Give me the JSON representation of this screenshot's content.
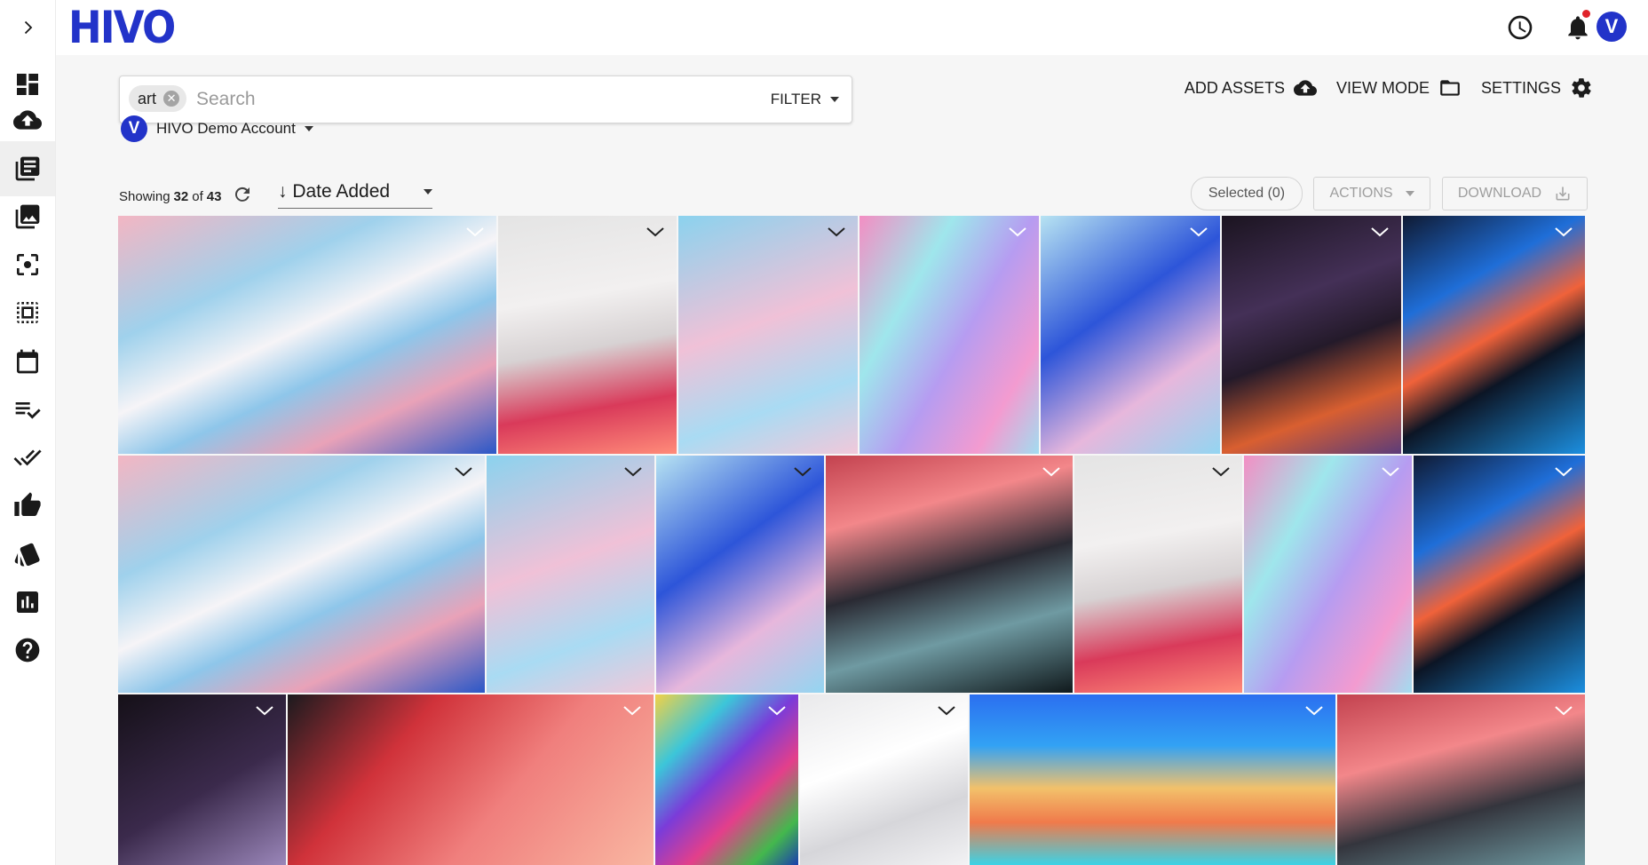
{
  "brand": {
    "logo": "HIVO",
    "color": "#2233c9"
  },
  "sidebar": {
    "expand_icon": "chevron-right-icon",
    "items": [
      {
        "name": "dashboard",
        "icon": "dashboard-icon"
      },
      {
        "name": "upload",
        "icon": "cloud-upload-icon"
      },
      {
        "name": "library",
        "icon": "library-icon",
        "active": true
      },
      {
        "name": "collections",
        "icon": "photo-library-icon"
      },
      {
        "name": "scan",
        "icon": "center-focus-icon"
      },
      {
        "name": "select",
        "icon": "select-all-icon"
      },
      {
        "name": "calendar",
        "icon": "calendar-icon"
      },
      {
        "name": "checklist",
        "icon": "playlist-check-icon"
      },
      {
        "name": "approvals",
        "icon": "done-all-icon"
      },
      {
        "name": "likes",
        "icon": "thumb-up-icon"
      },
      {
        "name": "brand",
        "icon": "cards-icon"
      },
      {
        "name": "analytics",
        "icon": "bar-chart-icon"
      },
      {
        "name": "help",
        "icon": "help-icon"
      }
    ]
  },
  "header": {
    "icons": [
      "history-icon",
      "bell-icon"
    ],
    "avatar_letter": "V"
  },
  "search": {
    "chip": "art",
    "placeholder": "Search",
    "filter_label": "FILTER"
  },
  "toolbar": {
    "add_assets": "ADD ASSETS",
    "view_mode": "VIEW MODE",
    "settings": "SETTINGS"
  },
  "account": {
    "avatar_letter": "V",
    "name": "HIVO Demo Account"
  },
  "results": {
    "showing_prefix": "Showing",
    "shown": "32",
    "of": "of",
    "total": "43",
    "sort_label": "↓ Date Added"
  },
  "bulk": {
    "selected": "Selected (0)",
    "actions": "ACTIONS",
    "download": "DOWNLOAD"
  },
  "assets": [
    {
      "id": "a1",
      "bg": "linear-gradient(155deg,#f3b6c3 0%,#9fd1ec 30%,#f6f4f7 48%,#8ec6ea 62%,#e9a2b8 78%,#2a57c7 100%)"
    },
    {
      "id": "a2",
      "bg": "linear-gradient(170deg,#e4e4e4 0%,#f2f0f0 35%,#d7d2d3 55%,#d93a5a 78%,#ff8b79 100%)"
    },
    {
      "id": "a3",
      "bg": "linear-gradient(160deg,#8bd2ee 0%,#f0c1d7 45%,#a9dbf3 75%,#f1c8da 100%)"
    },
    {
      "id": "a4",
      "bg": "linear-gradient(120deg,#f38ec3 0%,#9fe6ec 30%,#b69cf1 55%,#f39bd0 80%,#a2dcf0 100%)"
    },
    {
      "id": "a5",
      "bg": "linear-gradient(145deg,#b7e3f2 0%,#2d55d9 40%,#e7b7dc 70%,#93d5f1 100%)"
    },
    {
      "id": "a6",
      "bg": "linear-gradient(160deg,#1b1420 0%,#443057 35%,#241a2a 55%,#d95f30 78%,#5b3c7a 100%)"
    },
    {
      "id": "a7",
      "bg": "linear-gradient(150deg,#0f1a33 0%,#1f6ed8 30%,#f0623a 50%,#0c1525 65%,#1c8fe0 100%)"
    },
    {
      "id": "b1",
      "bg": "linear-gradient(155deg,#f3b6c3 0%,#9fd1ec 30%,#f6f4f7 48%,#8ec6ea 62%,#e9a2b8 78%,#2a57c7 100%)"
    },
    {
      "id": "b2",
      "bg": "linear-gradient(160deg,#8bd2ee 0%,#f0c1d7 45%,#a9dbf3 75%,#f1c8da 100%)"
    },
    {
      "id": "b3",
      "bg": "linear-gradient(145deg,#b7e3f2 0%,#2d55d9 40%,#e7b7dc 70%,#93d5f1 100%)"
    },
    {
      "id": "b4",
      "bg": "linear-gradient(165deg,#c3424f 0%,#f3878a 25%,#2a2a33 50%,#6f9aa2 72%,#10191c 100%)"
    },
    {
      "id": "b5",
      "bg": "linear-gradient(170deg,#e4e4e4 0%,#f2f0f0 35%,#d7d2d3 55%,#d93a5a 78%,#ff8b79 100%)"
    },
    {
      "id": "b6",
      "bg": "linear-gradient(120deg,#f38ec3 0%,#9fe6ec 30%,#b69cf1 55%,#f39bd0 80%,#a2dcf0 100%)"
    },
    {
      "id": "b7",
      "bg": "linear-gradient(150deg,#0f1a33 0%,#1f6ed8 30%,#f0623a 50%,#0c1525 65%,#1c8fe0 100%)"
    },
    {
      "id": "c1",
      "bg": "linear-gradient(150deg,#151018 0%,#3b2a4c 55%,#9a86b9 100%)"
    },
    {
      "id": "c2",
      "bg": "linear-gradient(130deg,#1b1a1e 0%,#d0323a 30%,#f07f7d 60%,#f9b7a2 100%)"
    },
    {
      "id": "c3",
      "bg": "linear-gradient(135deg,#f2d146 0%,#3cc6d9 25%,#7a3cd9 45%,#e43f8a 65%,#44b84d 85%,#1a3fae 100%)"
    },
    {
      "id": "c4",
      "bg": "linear-gradient(160deg,#e9e9eb 0%,#ffffff 40%,#d6d6da 70%,#f2f2f4 100%)"
    },
    {
      "id": "c5",
      "bg": "linear-gradient(180deg,#2b6ff0 0%,#32a2f4 30%,#f2c16b 55%,#f07a4b 75%,#3bd3e6 100%)"
    },
    {
      "id": "c6",
      "bg": "linear-gradient(165deg,#c3424f 0%,#f3878a 35%,#34353d 65%,#6f9aa2 100%)"
    }
  ]
}
